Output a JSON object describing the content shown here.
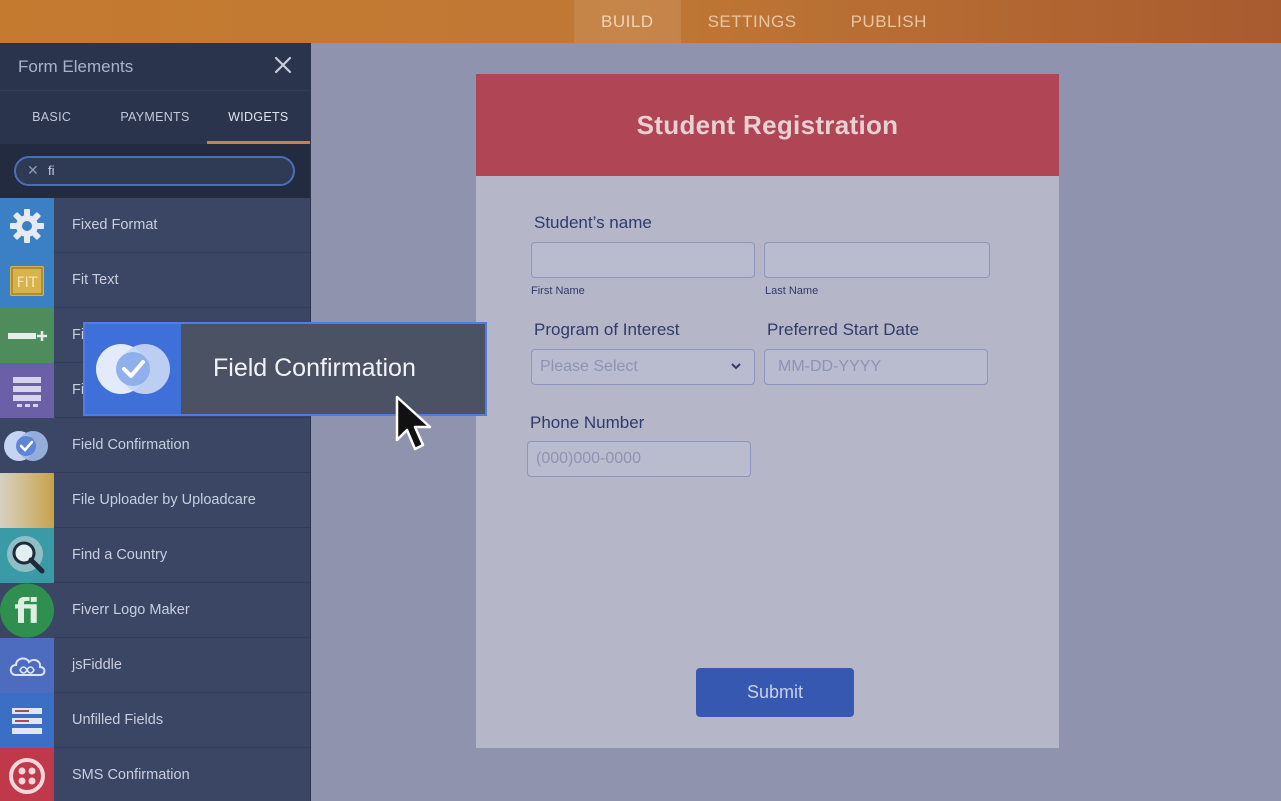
{
  "topnav": {
    "tabs": [
      "BUILD",
      "SETTINGS",
      "PUBLISH"
    ],
    "active": "BUILD"
  },
  "sidebar": {
    "title": "Form Elements",
    "tabs": [
      "BASIC",
      "PAYMENTS",
      "WIDGETS"
    ],
    "active_tab": "WIDGETS",
    "search": {
      "value": "fi"
    },
    "items": [
      {
        "label": "Fixed Format",
        "icon": "gear-icon",
        "color": "#3b7fc4"
      },
      {
        "label": "Fit Text",
        "icon": "fit-text-icon",
        "color": "#3b7fc4"
      },
      {
        "label": "Fi",
        "icon": "field-add-icon",
        "color": "#4e8c5c"
      },
      {
        "label": "Fi",
        "icon": "list-icon",
        "color": "#6b5fa8"
      },
      {
        "label": "Field Confirmation",
        "icon": "field-confirmation-icon",
        "color": "#3a4664"
      },
      {
        "label": "File Uploader by Uploadcare",
        "icon": "uploadcare-icon",
        "color": "#c8a24a"
      },
      {
        "label": "Find a Country",
        "icon": "magnifier-globe-icon",
        "color": "#3a9aa6"
      },
      {
        "label": "Fiverr Logo Maker",
        "icon": "fiverr-icon",
        "color": "#2e8f4e"
      },
      {
        "label": "jsFiddle",
        "icon": "cloud-icon",
        "color": "#4d6bbf"
      },
      {
        "label": "Unfilled Fields",
        "icon": "lines-icon",
        "color": "#3b6fc6"
      },
      {
        "label": "SMS Confirmation",
        "icon": "twilio-icon",
        "color": "#c0394b"
      }
    ]
  },
  "drag_card": {
    "label": "Field Confirmation"
  },
  "form": {
    "title": "Student Registration",
    "student_name_label": "Student’s name",
    "first_name_sub": "First Name",
    "last_name_sub": "Last Name",
    "program_label": "Program of Interest",
    "program_placeholder": "Please Select",
    "start_date_label": "Preferred Start Date",
    "start_date_placeholder": "MM-DD-YYYY",
    "phone_label": "Phone Number",
    "phone_placeholder": "(000)000-0000",
    "submit_label": "Submit"
  },
  "colors": {
    "header_accent": "#b04655",
    "submit": "#3658b0",
    "drag_highlight": "#3f6fd8"
  }
}
